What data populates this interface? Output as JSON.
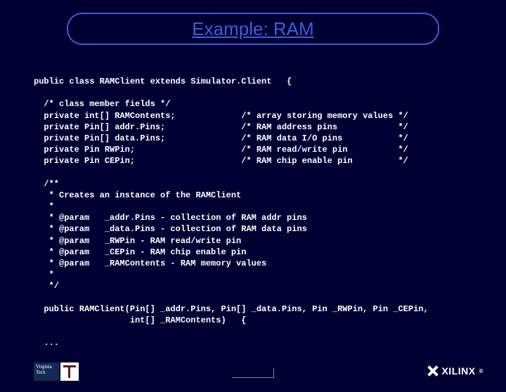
{
  "title": "Example: RAM",
  "code": "public class RAMClient extends Simulator.Client   {\n\n  /* class member fields */\n  private int[] RAMContents;             /* array storing memory values */\n  private Pin[] addr.Pins;               /* RAM address pins            */\n  private Pin[] data.Pins;               /* RAM data I/O pins           */\n  private Pin RWPin;                     /* RAM read/write pin          */\n  private Pin CEPin;                     /* RAM chip enable pin         */\n\n  /**\n   * Creates an instance of the RAMClient\n   *\n   * @param   _addr.Pins - collection of RAM addr pins\n   * @param   _data.Pins - collection of RAM data pins\n   * @param   _RWPin - RAM read/write pin\n   * @param   _CEPin - RAM chip enable pin\n   * @param   _RAMContents - RAM memory values\n   *\n   */\n\n  public RAMClient(Pin[] _addr.Pins, Pin[] _data.Pins, Pin _RWPin, Pin _CEPin,\n                   int[] _RAMContents)   {\n\n  ...",
  "footer": {
    "left_logo_line1": "Virginia",
    "left_logo_line2": "Tech",
    "right_logo": "XILINX",
    "right_logo_reg": "®"
  }
}
